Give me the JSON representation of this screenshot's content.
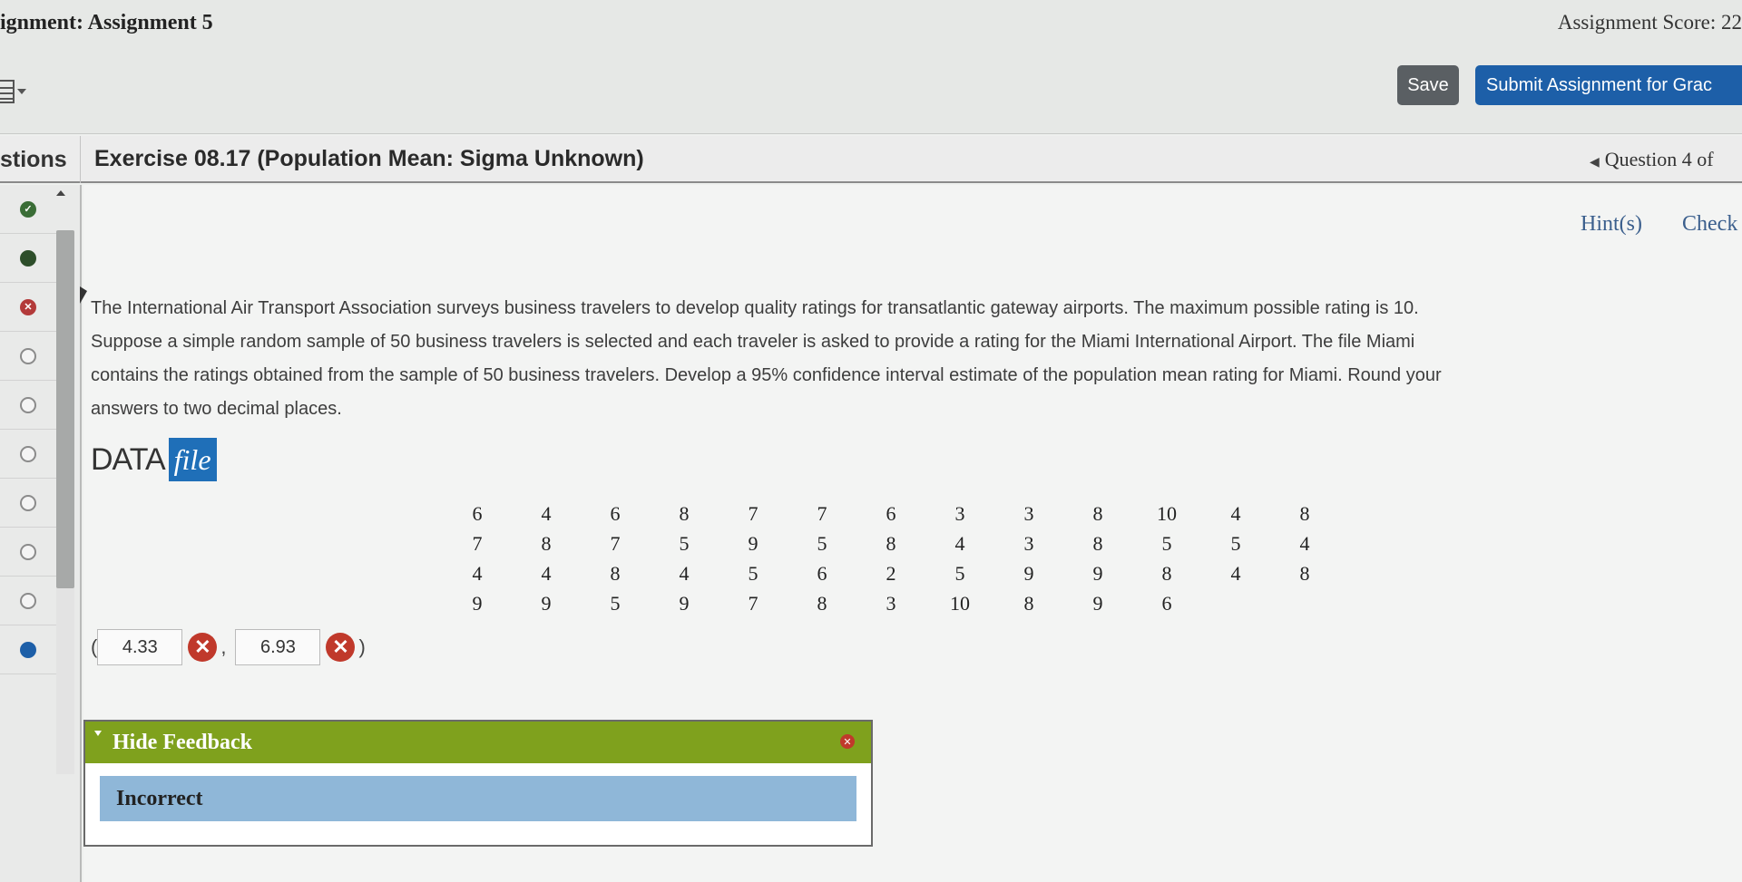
{
  "header": {
    "assignment_title": "ignment: Assignment 5",
    "assignment_score": "Assignment Score: 22",
    "save_label": "Save",
    "submit_label": "Submit Assignment for Grac"
  },
  "qbar": {
    "questions_label": "stions",
    "exercise_title": "Exercise 08.17 (Population Mean: Sigma Unknown)",
    "question_nav": "Question 4 of"
  },
  "sidebar": {
    "questions": [
      {
        "status": "correct"
      },
      {
        "status": "partial"
      },
      {
        "status": "incorrect"
      },
      {
        "status": "unanswered"
      },
      {
        "status": "unanswered"
      },
      {
        "status": "unanswered"
      },
      {
        "status": "unanswered"
      },
      {
        "status": "unanswered"
      },
      {
        "status": "unanswered"
      },
      {
        "status": "current"
      }
    ]
  },
  "main": {
    "hint_label": "Hint(s)",
    "check_work_label": "Check My Wo",
    "question_lines": [
      "The International Air Transport Association surveys business travelers to develop quality ratings for transatlantic gateway airports. The maximum possible rating is 10.",
      "Suppose a simple random sample of 50 business travelers is selected and each traveler is asked to provide a rating for the Miami International Airport. The file Miami",
      "contains the ratings obtained from the sample of 50 business travelers. Develop a 95% confidence interval estimate of the population mean rating for Miami. Round your",
      "answers to two decimal places."
    ],
    "data_logo": {
      "data_word": "DATA",
      "file_word": "file"
    },
    "data_table": [
      [
        "6",
        "4",
        "6",
        "8",
        "7",
        "7",
        "6",
        "3",
        "3",
        "8",
        "10",
        "4",
        "8"
      ],
      [
        "7",
        "8",
        "7",
        "5",
        "9",
        "5",
        "8",
        "4",
        "3",
        "8",
        "5",
        "5",
        "4"
      ],
      [
        "4",
        "4",
        "8",
        "4",
        "5",
        "6",
        "2",
        "5",
        "9",
        "9",
        "8",
        "4",
        "8"
      ],
      [
        "9",
        "9",
        "5",
        "9",
        "7",
        "8",
        "3",
        "10",
        "8",
        "9",
        "6",
        "",
        ""
      ]
    ],
    "answer": {
      "open_paren": "(",
      "lower": "4.33",
      "comma": ",",
      "upper": "6.93",
      "close_paren": ")"
    },
    "feedback": {
      "title": "Hide Feedback",
      "result": "Incorrect"
    }
  }
}
